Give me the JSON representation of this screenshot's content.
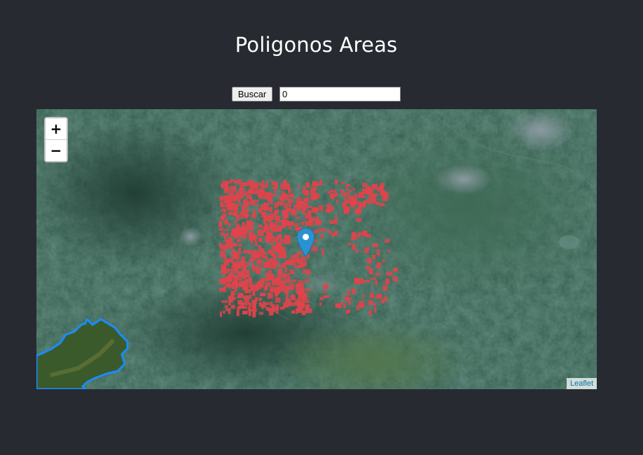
{
  "page": {
    "title": "Poligonos Areas"
  },
  "search": {
    "button_label": "Buscar",
    "value": "0"
  },
  "map": {
    "zoom_in_label": "+",
    "zoom_out_label": "−",
    "attribution": "Leaflet",
    "marker_icon": "map-pin-icon",
    "colors": {
      "polygon_fill": "#e0434b",
      "boundary_line": "#1a8cff",
      "marker": "#2a92d1",
      "attribution_link": "#0078a8"
    }
  }
}
